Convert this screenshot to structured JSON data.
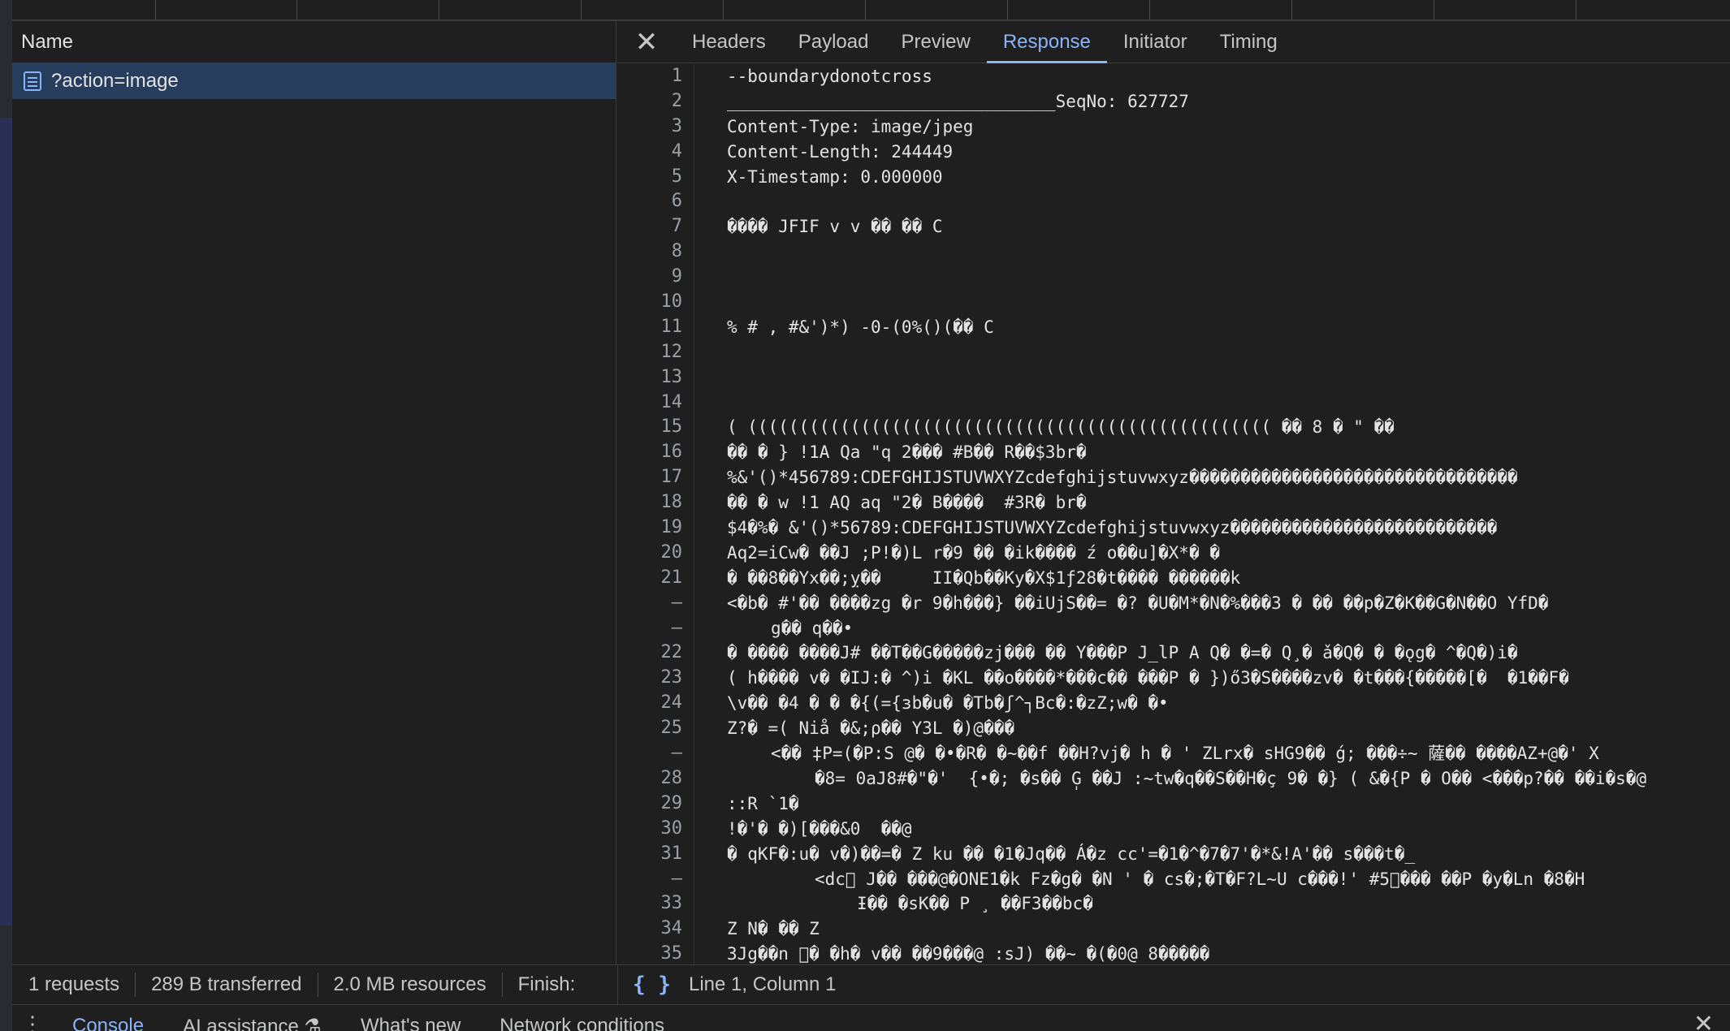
{
  "request_list": {
    "column_header": "Name",
    "rows": [
      {
        "name": "?action=image"
      }
    ]
  },
  "detail_tabs": {
    "items": [
      "Headers",
      "Payload",
      "Preview",
      "Response",
      "Initiator",
      "Timing"
    ],
    "active": "Response"
  },
  "response": {
    "line_numbers": [
      "1",
      "2",
      "3",
      "4",
      "5",
      "6",
      "7",
      "8",
      "9",
      "10",
      "11",
      "12",
      "13",
      "14",
      "15",
      "16",
      "17",
      "18",
      "19",
      "20",
      "21",
      "–",
      "–",
      "22",
      "23",
      "24",
      "25",
      "–",
      "28",
      "29",
      "30",
      "31",
      "–",
      "33",
      "34",
      "35"
    ],
    "lines": [
      "--boundarydonotcross",
      "________________________________SeqNo: 627727",
      "Content-Type: image/jpeg",
      "Content-Length: 244449",
      "X-Timestamp: 0.000000",
      "",
      "���� JFIF v v �� �� C",
      "",
      "",
      "",
      "% # , #&')*) -0-(0%()(�� C",
      "",
      "",
      "",
      "( ((((((((((((((((((((((((((((((((((((((((((((((((((( �� 8 � \" ��",
      "�� � } !1A Qa \"q 2��� #B�� R��$3br�",
      "%&'()*456789:CDEFGHIJSTUVWXYZcdefghijstuvwxyz��������������������������������",
      "�� � w !1 AQ aq \"2� B����  #3R� br�",
      "$4�%� &'()*56789:CDEFGHIJSTUVWXYZcdefghijstuvwxyz��������������������������",
      "Aq2=iCw� ��J ;P!�)L r�9 �� �ik���� ź o��u]�X*� �",
      "� ��8��Yx��;ỵ��     II�Qb��Ky�X$1ƒ28�t���� ������k",
      "<�b� #'�� ����zg �r 9�h���} ��iUjS��= �? �U�M*�N�%���3 � �� ��p�Z�K��G�N��O YfD�",
      "g�� q��•",
      "� ���� ����J# ��T��G�����zj��� �� Y���P J_lP A Q� �=� Q¸� ǎ�Q� � �ǫg� ^�Q�)i�",
      "( h���� v� �IJ:� ^)i �KL ��o����*���c�� ���P � })ő3�S����zv� �t���{�����[�  �1��F�",
      "\\v�� �4 � � �{(={ɜb�u� �Tb�ʃ^┐Bc�:�zZ;w� �•",
      "Z?� =( Niå �&;ρ�� Y3L �)@���",
      "<�� ‡P=(�P:S @� �•�R� �~��f ��H?vj� h � ' ZLrx� sHG9�� ǵ; ���÷~ 薩�� ����AZ+@�' X",
      "�8= 0aJ8#�\"�'  {•�; �s�� ̩G ��J :~tw�q��S��H�ç 9� �} ( &�{P � O�� <���p?�� ��i�s�@",
      "::R `1�",
      "!�'� �)[���&0  ��@",
      "� qKF�:u� v�)��=� Z ku �� �1�Jq�� Á�z cc'=�1�^�7�7'�*&!A'�� s���t�_",
      "<dc⃞ J�� ���@�ONE1�k Fz�g� �N ' � cs�;�T�F?L~U c���!' #5⃞��� ��P �y�Ln �8�H",
      "Ɨ�� �sK�� P ¸ ��F3��bc�",
      "Z N� �� Z",
      "3Jg��n ⃞� �h� v�� ��9���@ :sJ) ��~ �(�0@ 8�����"
    ]
  },
  "status_bar": {
    "requests": "1 requests",
    "transferred": "289 B transferred",
    "resources": "2.0 MB resources",
    "finish": "Finish:",
    "braces": "{ }",
    "cursor": "Line 1, Column 1"
  },
  "drawer": {
    "tabs": [
      "Console",
      "AI assistance",
      "What's new",
      "Network conditions"
    ],
    "active": "Console",
    "ai_badge": "⚗"
  }
}
